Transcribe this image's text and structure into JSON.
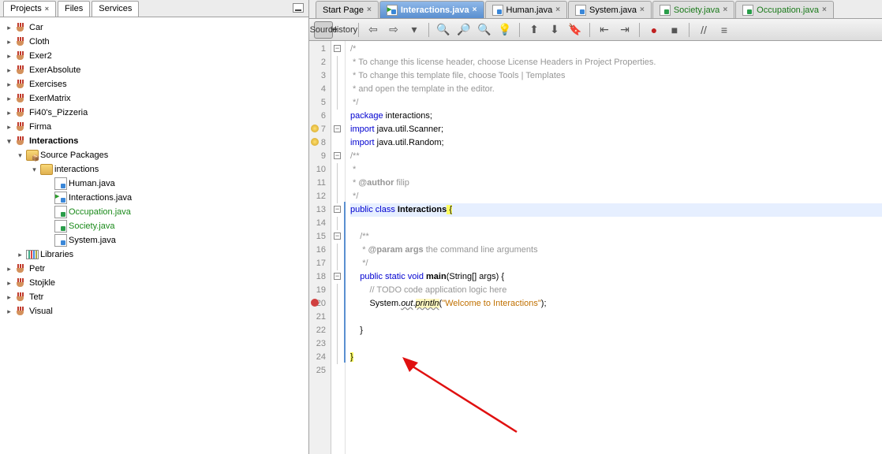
{
  "leftTabs": {
    "projects": "Projects",
    "files": "Files",
    "services": "Services"
  },
  "projects": [
    {
      "name": "Car"
    },
    {
      "name": "Cloth"
    },
    {
      "name": "Exer2"
    },
    {
      "name": "ExerAbsolute"
    },
    {
      "name": "Exercises"
    },
    {
      "name": "ExerMatrix"
    },
    {
      "name": "Fi40's_Pizzeria"
    },
    {
      "name": "Firma"
    }
  ],
  "activeProject": {
    "name": "Interactions",
    "srcPkg": "Source Packages",
    "pkg": "interactions",
    "files": [
      "Human.java",
      "Interactions.java",
      "Occupation.java",
      "Society.java",
      "System.java"
    ],
    "greenFiles": [
      "Occupation.java",
      "Society.java"
    ],
    "lib": "Libraries"
  },
  "projectsAfter": [
    {
      "name": "Petr"
    },
    {
      "name": "Stojkle"
    },
    {
      "name": "Tetr"
    },
    {
      "name": "Visual"
    }
  ],
  "editorTabs": [
    {
      "label": "Start Page",
      "type": "start"
    },
    {
      "label": "Interactions.java",
      "type": "java-main",
      "active": true
    },
    {
      "label": "Human.java",
      "type": "java"
    },
    {
      "label": "System.java",
      "type": "java"
    },
    {
      "label": "Society.java",
      "type": "java-green"
    },
    {
      "label": "Occupation.java",
      "type": "java-green"
    }
  ],
  "toolbar": {
    "source": "Source",
    "history": "History"
  },
  "code": {
    "l1": "/*",
    "l2": " * To change this license header, choose License Headers in Project Properties.",
    "l3": " * To change this template file, choose Tools | Templates",
    "l4": " * and open the template in the editor.",
    "l5": " */",
    "l6_kw": "package",
    "l6_rest": " interactions;",
    "l7_kw": "import",
    "l7_rest": " java.util.Scanner;",
    "l8_kw": "import",
    "l8_rest": " java.util.Random;",
    "l9": "/**",
    "l10": " *",
    "l11a": " * ",
    "l11b": "@author",
    "l11c": " filip",
    "l12": " */",
    "l13a": "public class ",
    "l13b": "Interactions",
    "l13c": " {",
    "l15": "    /**",
    "l16a": "     * ",
    "l16b": "@param",
    "l16c": " args",
    "l16d": " the command line arguments",
    "l17": "     */",
    "l18a": "    public static void ",
    "l18b": "main",
    "l18c": "(String[] args) {",
    "l19": "        // TODO code application logic here",
    "l20a": "        System.",
    "l20b": "out",
    "l20c": ".",
    "l20d": "println",
    "l20e": "(",
    "l20f": "\"Welcome to Interactions\"",
    "l20g": ");",
    "l22": "    }",
    "l24": "}"
  },
  "lineNumbers": [
    1,
    2,
    3,
    4,
    5,
    6,
    7,
    8,
    9,
    10,
    11,
    12,
    13,
    14,
    15,
    16,
    17,
    18,
    19,
    20,
    21,
    22,
    23,
    24,
    25
  ]
}
